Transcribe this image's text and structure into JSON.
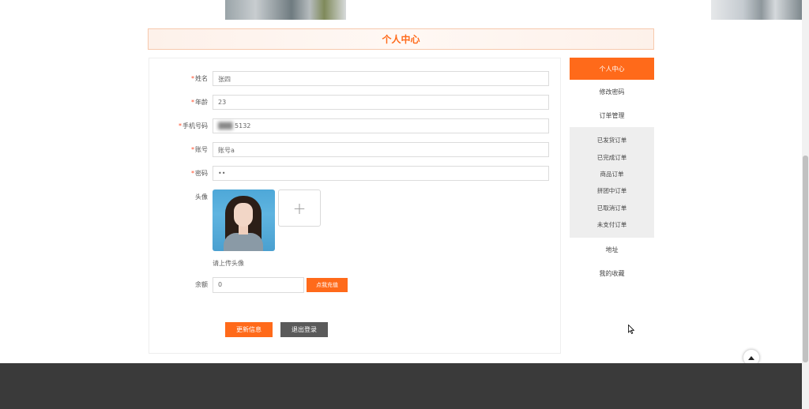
{
  "title": "个人中心",
  "form": {
    "name_label": "姓名",
    "name_value": "张四",
    "age_label": "年龄",
    "age_value": "23",
    "phone_label": "手机号码",
    "phone_value": "5132",
    "account_label": "账号",
    "account_value": "账号a",
    "password_label": "密码",
    "password_value": "••",
    "avatar_label": "头像",
    "upload_hint": "请上传头像",
    "upload_plus": "+",
    "balance_label": "余额",
    "balance_value": "0",
    "recharge_label": "点我充值",
    "update_label": "更新信息",
    "logout_label": "退出登录"
  },
  "side_menu": {
    "items": [
      {
        "label": "个人中心",
        "active": true
      },
      {
        "label": "修改密码"
      },
      {
        "label": "订单管理"
      }
    ],
    "order_sub": [
      "已发货订单",
      "已完成订单",
      "商品订单",
      "拼团中订单",
      "已取消订单",
      "未支付订单"
    ],
    "bottom_items": [
      {
        "label": "地址"
      },
      {
        "label": "我的收藏"
      }
    ]
  },
  "colors": {
    "accent": "#ff6a1a",
    "logout": "#5a5a5a",
    "footer": "#3a3a3a"
  },
  "icons": {
    "back_to_top": "chevron-up-icon",
    "upload": "plus-icon",
    "cursor": "mouse-pointer-icon"
  }
}
